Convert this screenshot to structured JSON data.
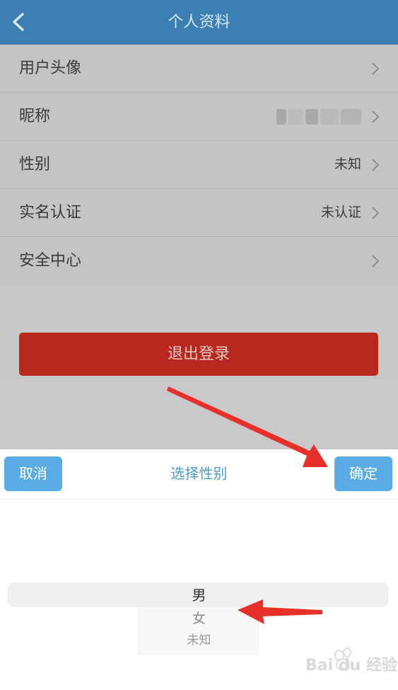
{
  "header": {
    "title": "个人资料"
  },
  "rows": [
    {
      "label": "用户头像",
      "value": ""
    },
    {
      "label": "昵称",
      "value": ""
    },
    {
      "label": "性别",
      "value": "未知"
    },
    {
      "label": "实名认证",
      "value": "未认证"
    },
    {
      "label": "安全中心",
      "value": ""
    }
  ],
  "logout_label": "退出登录",
  "sheet": {
    "cancel_label": "取消",
    "title": "选择性别",
    "confirm_label": "确定",
    "options": [
      "男",
      "女",
      "未知"
    ]
  },
  "watermark": "Bai du 经验",
  "colors": {
    "nav": "#3b7fb3",
    "logout": "#b8281e",
    "accent": "#5aace6",
    "arrow": "#e8302a"
  }
}
